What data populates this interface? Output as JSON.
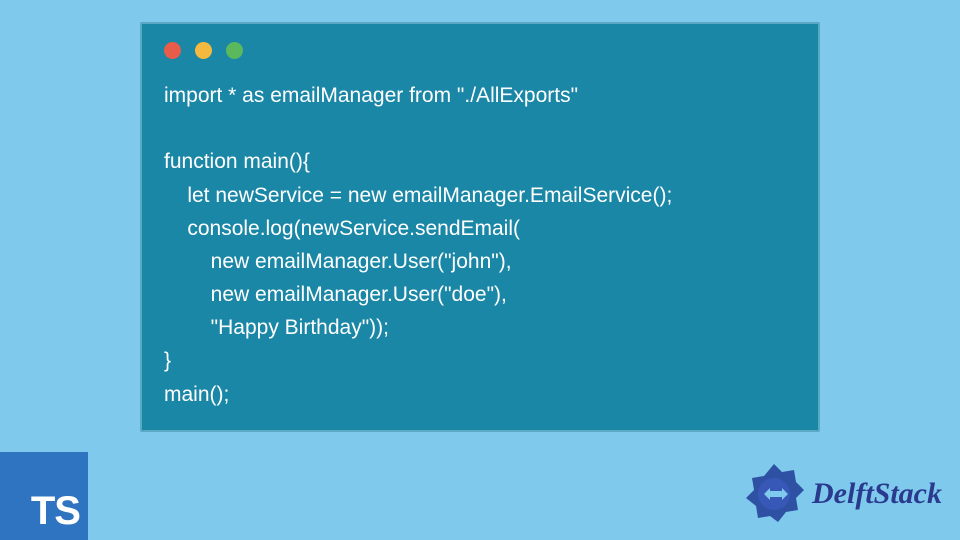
{
  "window": {
    "traffic_colors": {
      "red": "#e85c4a",
      "yellow": "#f4b93e",
      "green": "#5cb85c"
    }
  },
  "code": {
    "lines": [
      "import * as emailManager from \"./AllExports\"",
      "",
      "function main(){",
      "    let newService = new emailManager.EmailService();",
      "    console.log(newService.sendEmail(",
      "        new emailManager.User(\"john\"),",
      "        new emailManager.User(\"doe\"),",
      "        \"Happy Birthday\"));",
      "}",
      "main();"
    ]
  },
  "ts_badge": {
    "label": "TS"
  },
  "brand": {
    "name": "DelftStack"
  }
}
